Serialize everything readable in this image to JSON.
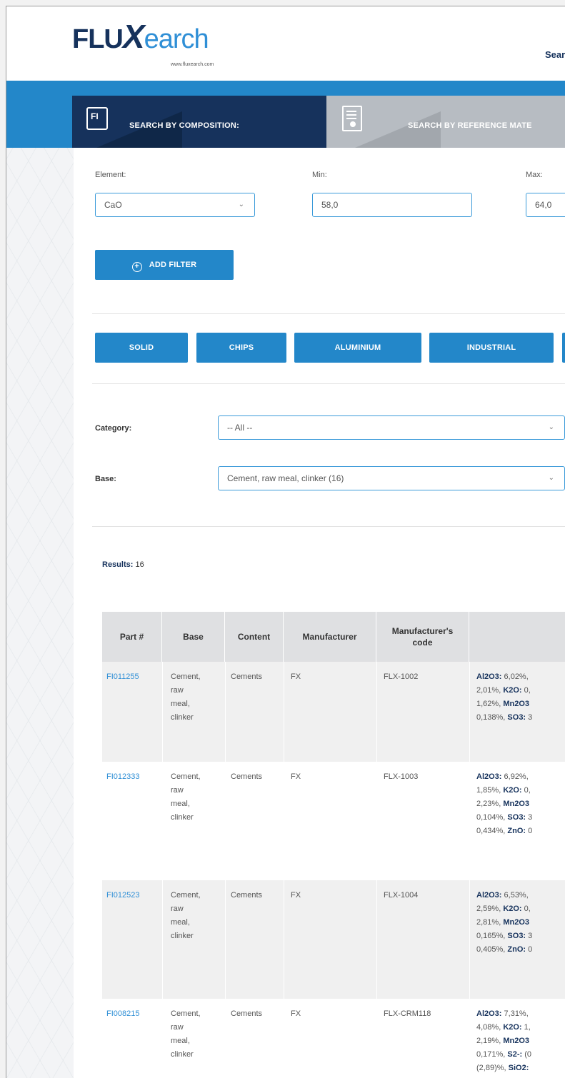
{
  "logo": {
    "flu": "FLU",
    "x": "X",
    "rest": "earch",
    "url": "www.fluxearch.com"
  },
  "nav": {
    "search": "Sear"
  },
  "tabs": [
    {
      "label": "SEARCH BY COMPOSITION:",
      "icon_text": "FI"
    },
    {
      "label": "SEARCH BY REFERENCE MATE"
    }
  ],
  "filters": {
    "element_label": "Element:",
    "min_label": "Min:",
    "max_label": "Max:",
    "element_value": "CaO",
    "min_value": "58,0",
    "max_value": "64,0",
    "add_filter": "ADD FILTER"
  },
  "quick_buttons": [
    "SOLID",
    "CHIPS",
    "ALUMINIUM",
    "INDUSTRIAL"
  ],
  "category": {
    "label": "Category:",
    "value": "-- All --"
  },
  "base": {
    "label": "Base:",
    "value": "Cement, raw meal, clinker (16)"
  },
  "results": {
    "label": "Results:",
    "count": "16"
  },
  "table": {
    "headers": [
      "Part #",
      "Base",
      "Content",
      "Manufacturer",
      "Manufacturer's code"
    ],
    "rows": [
      {
        "part": "FI011255",
        "base": [
          "Cement,",
          "raw",
          "meal,",
          "clinker"
        ],
        "content": "Cements",
        "manufacturer": "FX",
        "code": "FLX-1002",
        "comp": [
          [
            {
              "b": "Al2O3:",
              "t": " 6,02%,"
            }
          ],
          [
            {
              "b": "",
              "t": "2,01%, "
            },
            {
              "b": "K2O:",
              "t": " 0,"
            }
          ],
          [
            {
              "b": "",
              "t": "1,62%, "
            },
            {
              "b": "Mn2O3",
              "t": ""
            }
          ],
          [
            {
              "b": "",
              "t": "0,138%, "
            },
            {
              "b": "SO3:",
              "t": " 3"
            }
          ]
        ]
      },
      {
        "part": "FI012333",
        "base": [
          "Cement,",
          "raw",
          "meal,",
          "clinker"
        ],
        "content": "Cements",
        "manufacturer": "FX",
        "code": "FLX-1003",
        "comp": [
          [
            {
              "b": "Al2O3:",
              "t": " 6,92%,"
            }
          ],
          [
            {
              "b": "",
              "t": "1,85%, "
            },
            {
              "b": "K2O:",
              "t": " 0,"
            }
          ],
          [
            {
              "b": "",
              "t": "2,23%, "
            },
            {
              "b": "Mn2O3",
              "t": ""
            }
          ],
          [
            {
              "b": "",
              "t": "0,104%, "
            },
            {
              "b": "SO3:",
              "t": " 3"
            }
          ],
          [
            {
              "b": "",
              "t": "0,434%, "
            },
            {
              "b": "ZnO:",
              "t": " 0"
            }
          ]
        ]
      },
      {
        "part": "FI012523",
        "base": [
          "Cement,",
          "raw",
          "meal,",
          "clinker"
        ],
        "content": "Cements",
        "manufacturer": "FX",
        "code": "FLX-1004",
        "comp": [
          [
            {
              "b": "Al2O3:",
              "t": " 6,53%,"
            }
          ],
          [
            {
              "b": "",
              "t": "2,59%, "
            },
            {
              "b": "K2O:",
              "t": " 0,"
            }
          ],
          [
            {
              "b": "",
              "t": "2,81%, "
            },
            {
              "b": "Mn2O3",
              "t": ""
            }
          ],
          [
            {
              "b": "",
              "t": "0,165%, "
            },
            {
              "b": "SO3:",
              "t": " 3"
            }
          ],
          [
            {
              "b": "",
              "t": "0,405%, "
            },
            {
              "b": "ZnO:",
              "t": " 0"
            }
          ]
        ]
      },
      {
        "part": "FI008215",
        "base": [
          "Cement,",
          "raw",
          "meal,",
          "clinker"
        ],
        "content": "Cements",
        "manufacturer": "FX",
        "code": "FLX-CRM118",
        "comp": [
          [
            {
              "b": "Al2O3:",
              "t": " 7,31%,"
            }
          ],
          [
            {
              "b": "",
              "t": "4,08%, "
            },
            {
              "b": "K2O:",
              "t": " 1,"
            }
          ],
          [
            {
              "b": "",
              "t": "2,19%, "
            },
            {
              "b": "Mn2O3",
              "t": ""
            }
          ],
          [
            {
              "b": "",
              "t": "0,171%, "
            },
            {
              "b": "S2-:",
              "t": " (0"
            }
          ],
          [
            {
              "b": "",
              "t": "(2,89)%, "
            },
            {
              "b": "SiO2:",
              "t": ""
            }
          ]
        ]
      }
    ]
  },
  "colors": {
    "navy": "#16325c",
    "blue": "#2387c9",
    "link": "#2f8fd6"
  }
}
